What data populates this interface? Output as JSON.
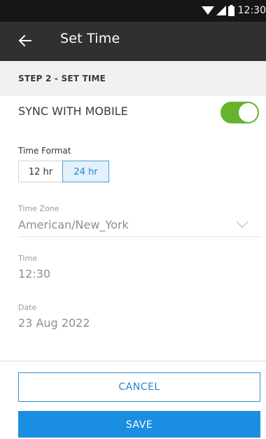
{
  "status_bar": {
    "time": "12:30"
  },
  "app_bar": {
    "title": "Set Time"
  },
  "step": {
    "label": "STEP 2 - SET TIME"
  },
  "sync": {
    "label": "SYNC WITH MOBILE",
    "enabled": true,
    "accent_color": "#67b32e"
  },
  "time_format": {
    "label": "Time Format",
    "options": [
      "12 hr",
      "24 hr"
    ],
    "selected": "24 hr"
  },
  "time_zone": {
    "label": "Time Zone",
    "value": "American/New_York"
  },
  "time": {
    "label": "Time",
    "value": "12:30"
  },
  "date": {
    "label": "Date",
    "value": "23 Aug 2022"
  },
  "actions": {
    "cancel_label": "CANCEL",
    "save_label": "SAVE",
    "primary_color": "#1a8ee0"
  }
}
